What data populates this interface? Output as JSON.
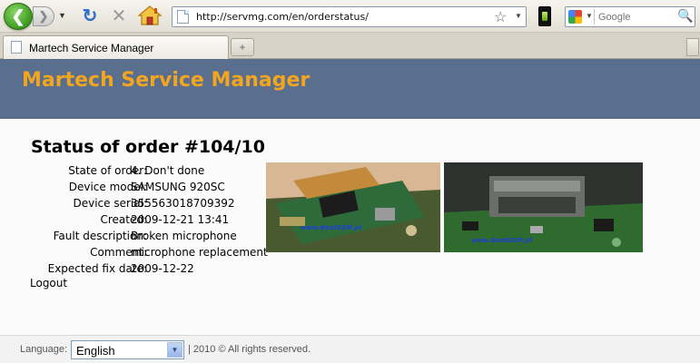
{
  "browser": {
    "url": "http://servmg.com/en/orderstatus/",
    "search_placeholder": "Google",
    "tab_title": "Martech Service Manager",
    "new_tab_symbol": "+"
  },
  "site": {
    "title": "Martech Service Manager",
    "title_color": "#f2a620",
    "header_color": "#5a6f8e"
  },
  "order": {
    "heading": "Status of order #104/10",
    "details": [
      {
        "label": "State of order:",
        "value": "4. Don't done"
      },
      {
        "label": "Device model:",
        "value": "SAMSUNG 920SC"
      },
      {
        "label": "Device serial:",
        "value": "355563018709392"
      },
      {
        "label": "Created:",
        "value": "2009-12-21 13:41"
      },
      {
        "label": "Fault description:",
        "value": "Broken microphone"
      },
      {
        "label": "Comment:",
        "value": "microphone replacement"
      },
      {
        "label": "Expected fix date:",
        "value": "2009-12-22"
      }
    ],
    "logout": "Logout"
  },
  "photos": [
    {
      "watermark": "www.BestGSM.pl"
    },
    {
      "watermark": "www.BestGSM.pl"
    }
  ],
  "footer": {
    "language_label": "Language:",
    "language_selected": "English",
    "copyright": "| 2010 © All rights reserved."
  }
}
